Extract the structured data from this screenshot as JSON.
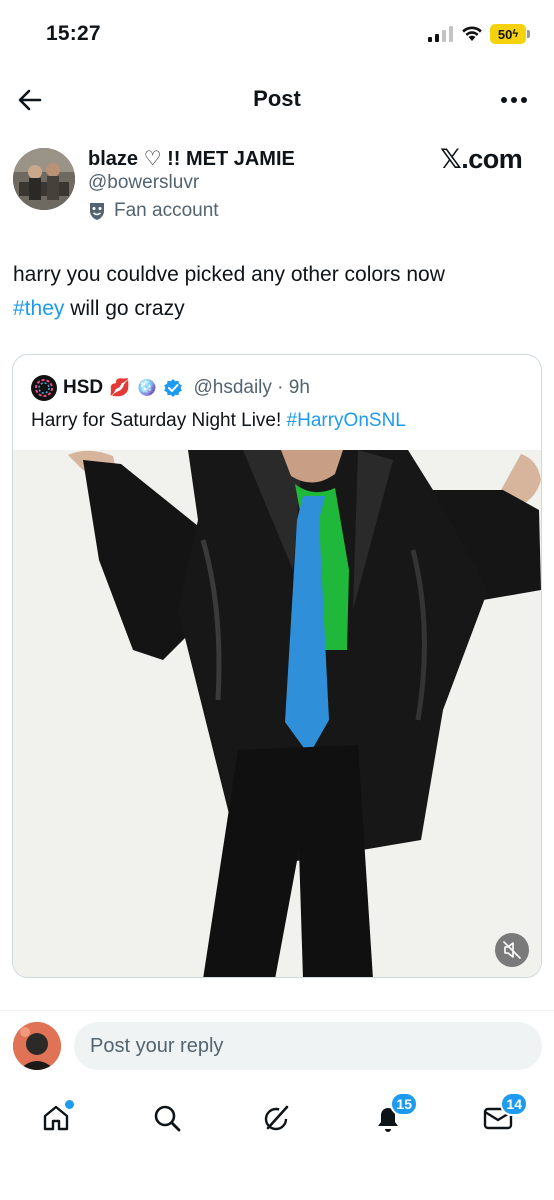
{
  "status_bar": {
    "time": "15:27",
    "battery": "50"
  },
  "header": {
    "title": "Post",
    "back_icon": "arrow-left-icon",
    "more_icon": "more-dots-icon"
  },
  "post": {
    "author_name": "blaze ♡ !! MET JAMIE",
    "author_handle": "@bowersluvr",
    "fan_label": "Fan account",
    "source_label": "𝕏.com",
    "text_part1": "harry you couldve picked any other colors now",
    "hashtag": "#they",
    "text_part2": " will go crazy"
  },
  "quote": {
    "name": "HSD",
    "emoji_lips": "💋",
    "emoji_ball": "🪩",
    "handle_time": "@hsdaily · 9h",
    "text": "Harry for Saturday Night Live!",
    "hashtag": "#HarryOnSNL"
  },
  "reply": {
    "placeholder": "Post your reply"
  },
  "nav": {
    "items": [
      {
        "name": "home",
        "icon": "home-icon"
      },
      {
        "name": "search",
        "icon": "search-icon"
      },
      {
        "name": "grok",
        "icon": "grok-icon"
      },
      {
        "name": "notifications",
        "icon": "bell-icon",
        "badge": "15"
      },
      {
        "name": "messages",
        "icon": "mail-icon",
        "badge": "14"
      }
    ]
  },
  "colors": {
    "accent": "#1d9bf0",
    "text": "#0f1419",
    "muted": "#536471",
    "battery": "#f5d20b"
  }
}
